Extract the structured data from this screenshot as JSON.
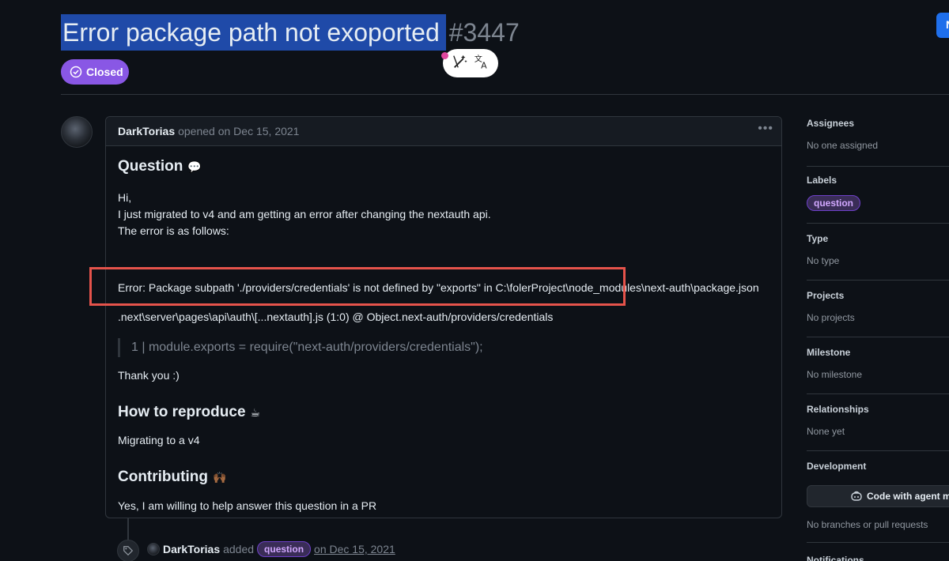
{
  "issue": {
    "title": "Error package path not exoported",
    "number": "#3447",
    "status": "Closed",
    "top_right_button": "N"
  },
  "comment": {
    "author": "DarkTorias",
    "action": "opened on Dec 15, 2021",
    "menu": "•••",
    "sections": {
      "question_heading": "Question",
      "question_emoji": "💬",
      "line1": "Hi,",
      "line2": "I just migrated to v4 and am getting an error after changing the nextauth api.",
      "line3": "The error is as follows:",
      "error_line": "Error: Package subpath './providers/credentials' is not defined by \"exports\" in C:\\folerProject\\node_modules\\next-auth\\package.json",
      "stack_line": ".next\\server\\pages\\api\\auth\\[...nextauth].js (1:0) @ Object.next-auth/providers/credentials",
      "quote_line": "1 | module.exports = require(\"next-auth/providers/credentials\");",
      "thanks": "Thank you :)",
      "reproduce_heading": "How to reproduce",
      "reproduce_emoji": "☕",
      "reproduce_text": "Migrating to a v4",
      "contributing_heading": "Contributing",
      "contributing_emoji": "🙌🏾",
      "contributing_text": "Yes, I am willing to help answer this question in a PR"
    }
  },
  "timeline_event": {
    "author": "DarkTorias",
    "verb": "added",
    "label": "question",
    "date": "on Dec 15, 2021"
  },
  "sidebar": {
    "assignees": {
      "title": "Assignees",
      "value": "No one assigned"
    },
    "labels": {
      "title": "Labels",
      "value": "question"
    },
    "type": {
      "title": "Type",
      "value": "No type"
    },
    "projects": {
      "title": "Projects",
      "value": "No projects"
    },
    "milestone": {
      "title": "Milestone",
      "value": "No milestone"
    },
    "relationships": {
      "title": "Relationships",
      "value": "None yet"
    },
    "development": {
      "title": "Development",
      "button": "Code with agent mo",
      "value": "No branches or pull requests"
    },
    "notifications": {
      "title": "Notifications"
    }
  },
  "colors": {
    "background": "#0d1117",
    "closed_badge": "#8957e5",
    "title_highlight": "#1f4aa8",
    "red_annotation": "#e5534b"
  }
}
